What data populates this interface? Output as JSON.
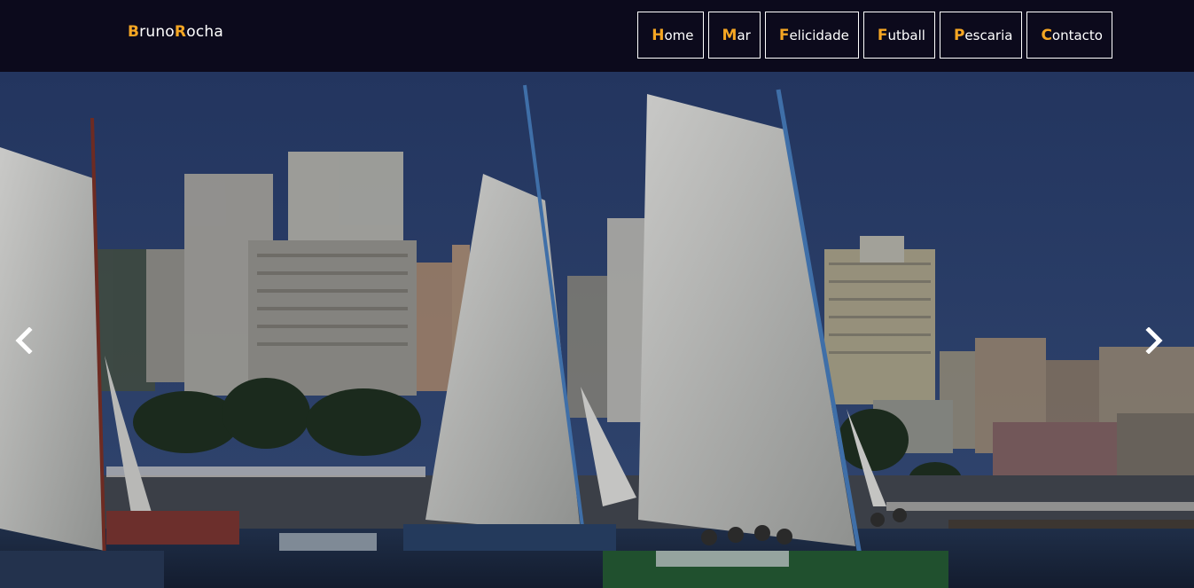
{
  "brand": {
    "initial_1": "B",
    "rest_1": "runo",
    "initial_2": "R",
    "rest_2": "ocha"
  },
  "nav": {
    "items": [
      {
        "initial": "H",
        "rest": "ome"
      },
      {
        "initial": "M",
        "rest": "ar"
      },
      {
        "initial": "F",
        "rest": "elicidade"
      },
      {
        "initial": "F",
        "rest": "utball"
      },
      {
        "initial": "P",
        "rest": "escaria"
      },
      {
        "initial": "C",
        "rest": "ontacto"
      }
    ]
  },
  "carousel": {
    "prev_icon": "chevron-left-icon",
    "next_icon": "chevron-right-icon"
  },
  "colors": {
    "navbar_bg": "#0c0a1c",
    "accent": "#f5a623",
    "text": "#ffffff"
  }
}
